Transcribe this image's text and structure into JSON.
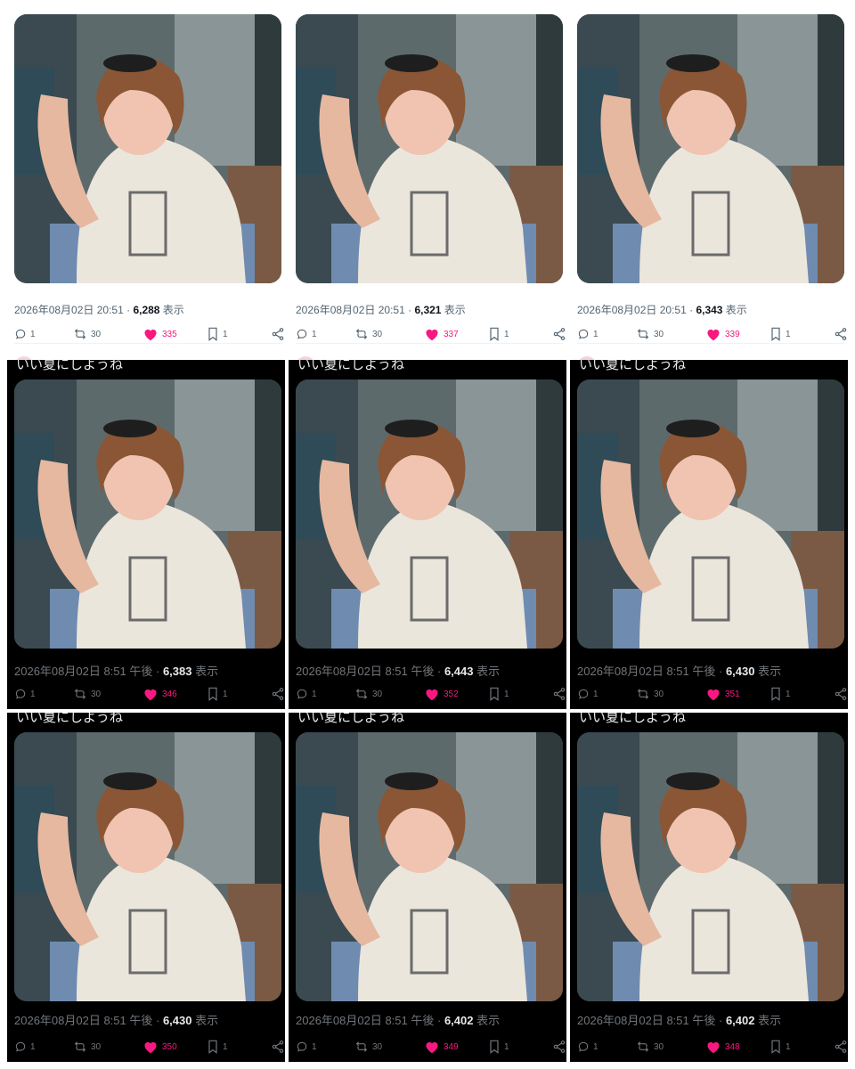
{
  "caption": "いい夏にしようね",
  "icons": {
    "reply": "speech-bubble-icon",
    "repost": "repost-arrows-icon",
    "like": "heart-icon",
    "bookmark": "bookmark-icon",
    "share": "share-icon"
  },
  "colors": {
    "like_pink": "#f91880",
    "dark_bg": "#000000",
    "light_bg": "#ffffff"
  },
  "tiles": [
    {
      "theme": "light",
      "date": "2026年08月02日 20:51",
      "dot": " · ",
      "views": "6,288",
      "views_label": " 表示",
      "replies": "1",
      "reposts": "30",
      "likes": "335",
      "bookmarks": "1"
    },
    {
      "theme": "light",
      "date": "2026年08月02日 20:51",
      "dot": " · ",
      "views": "6,321",
      "views_label": " 表示",
      "replies": "1",
      "reposts": "30",
      "likes": "337",
      "bookmarks": "1"
    },
    {
      "theme": "light",
      "date": "2026年08月02日 20:51",
      "dot": " · ",
      "views": "6,343",
      "views_label": " 表示",
      "replies": "1",
      "reposts": "30",
      "likes": "339",
      "bookmarks": "1"
    },
    {
      "theme": "dark",
      "date": "2026年08月02日 8:51 午後",
      "dot": " · ",
      "views": "6,383",
      "views_label": " 表示",
      "replies": "1",
      "reposts": "30",
      "likes": "346",
      "bookmarks": "1"
    },
    {
      "theme": "dark",
      "date": "2026年08月02日 8:51 午後",
      "dot": " · ",
      "views": "6,443",
      "views_label": " 表示",
      "replies": "1",
      "reposts": "30",
      "likes": "352",
      "bookmarks": "1"
    },
    {
      "theme": "dark",
      "date": "2026年08月02日 8:51 午後",
      "dot": " · ",
      "views": "6,430",
      "views_label": " 表示",
      "replies": "1",
      "reposts": "30",
      "likes": "351",
      "bookmarks": "1"
    },
    {
      "theme": "dark",
      "date": "2026年08月02日 8:51 午後",
      "dot": " · ",
      "views": "6,430",
      "views_label": " 表示",
      "replies": "1",
      "reposts": "30",
      "likes": "350",
      "bookmarks": "1"
    },
    {
      "theme": "dark",
      "date": "2026年08月02日 8:51 午後",
      "dot": " · ",
      "views": "6,402",
      "views_label": " 表示",
      "replies": "1",
      "reposts": "30",
      "likes": "349",
      "bookmarks": "1"
    },
    {
      "theme": "dark",
      "date": "2026年08月02日 8:51 午後",
      "dot": " · ",
      "views": "6,402",
      "views_label": " 表示",
      "replies": "1",
      "reposts": "30",
      "likes": "348",
      "bookmarks": "1"
    }
  ]
}
